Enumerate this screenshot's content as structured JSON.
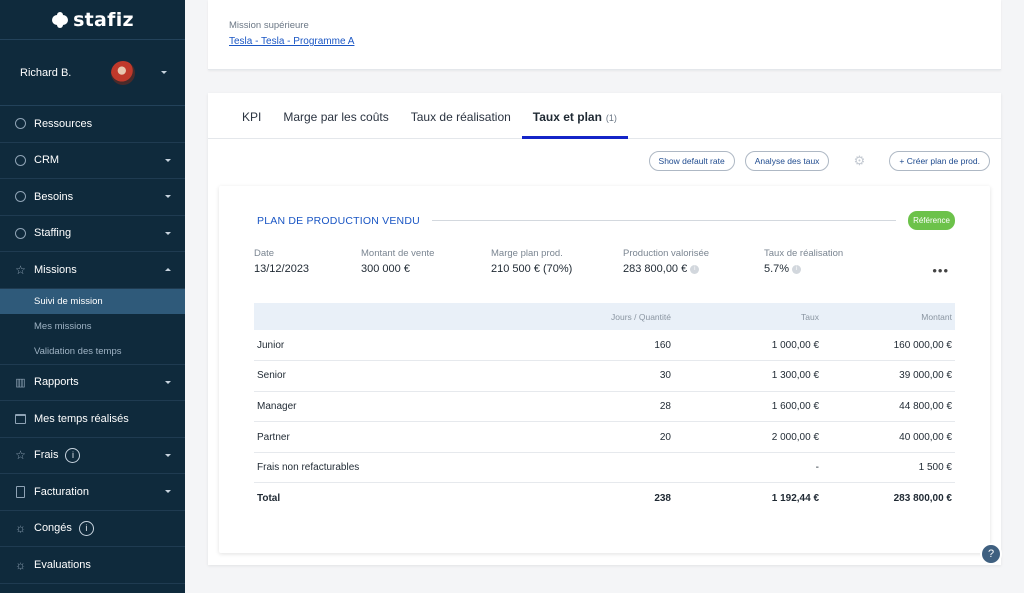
{
  "brand": {
    "name": "stafiz"
  },
  "user": {
    "name": "Richard B."
  },
  "sidebar": {
    "items": [
      {
        "label": "Ressources",
        "icon": "person-icon",
        "dropdown": false
      },
      {
        "label": "CRM",
        "icon": "person-icon",
        "dropdown": true
      },
      {
        "label": "Besoins",
        "icon": "person-icon",
        "dropdown": true
      },
      {
        "label": "Staffing",
        "icon": "clock-icon",
        "dropdown": true
      },
      {
        "label": "Missions",
        "icon": "star-icon",
        "dropdown": true,
        "expanded": true
      },
      {
        "label": "Rapports",
        "icon": "chart-icon",
        "dropdown": true
      },
      {
        "label": "Mes temps réalisés",
        "icon": "calendar-icon",
        "dropdown": false
      },
      {
        "label": "Frais",
        "icon": "star-icon",
        "dropdown": true,
        "info": "i"
      },
      {
        "label": "Facturation",
        "icon": "document-icon",
        "dropdown": true
      },
      {
        "label": "Congés",
        "icon": "sun-icon",
        "dropdown": false,
        "info": "i"
      },
      {
        "label": "Evaluations",
        "icon": "sun-icon",
        "dropdown": false
      }
    ],
    "missions_sub": [
      {
        "label": "Suivi de mission",
        "active": true
      },
      {
        "label": "Mes missions",
        "active": false
      },
      {
        "label": "Validation des temps",
        "active": false
      }
    ]
  },
  "parent_mission": {
    "label": "Mission supérieure",
    "link": "Tesla - Tesla - Programme A"
  },
  "tabs": [
    {
      "label": "KPI",
      "active": false,
      "count": ""
    },
    {
      "label": "Marge par les coûts",
      "active": false,
      "count": ""
    },
    {
      "label": "Taux de réalisation",
      "active": false,
      "count": ""
    },
    {
      "label": "Taux et plan",
      "active": true,
      "count": "(1)"
    }
  ],
  "actions": {
    "show_default_rate": "Show default rate",
    "analyse_taux": "Analyse des taux",
    "create_plan": "+ Créer plan de prod."
  },
  "plan": {
    "title": "PLAN DE PRODUCTION VENDU",
    "badge": "Référence",
    "stats": [
      {
        "label": "Date",
        "value": "13/12/2023",
        "info": false
      },
      {
        "label": "Montant de vente",
        "value": "300 000 €",
        "info": false
      },
      {
        "label": "Marge plan prod.",
        "value": "210 500 € (70%)",
        "info": false
      },
      {
        "label": "Production valorisée",
        "value": "283 800,00 €",
        "info": true
      },
      {
        "label": "Taux de réalisation",
        "value": "5.7%",
        "info": true
      }
    ],
    "more": "•••",
    "table": {
      "headers": [
        "",
        "Jours / Quantité",
        "Taux",
        "Montant"
      ],
      "rows": [
        [
          "Junior",
          "160",
          "1 000,00 €",
          "160 000,00 €"
        ],
        [
          "Senior",
          "30",
          "1 300,00 €",
          "39 000,00 €"
        ],
        [
          "Manager",
          "28",
          "1 600,00 €",
          "44 800,00 €"
        ],
        [
          "Partner",
          "20",
          "2 000,00 €",
          "40 000,00 €"
        ],
        [
          "Frais non refacturables",
          "",
          "-",
          "1 500 €"
        ]
      ],
      "total": [
        "Total",
        "238",
        "1 192,44 €",
        "283 800,00 €"
      ]
    }
  },
  "help": {
    "label": "?"
  },
  "colors": {
    "sidebar_bg": "#0f2a3c",
    "accent": "#1424c8",
    "link": "#1a56c4",
    "badge": "#6cc24a"
  }
}
